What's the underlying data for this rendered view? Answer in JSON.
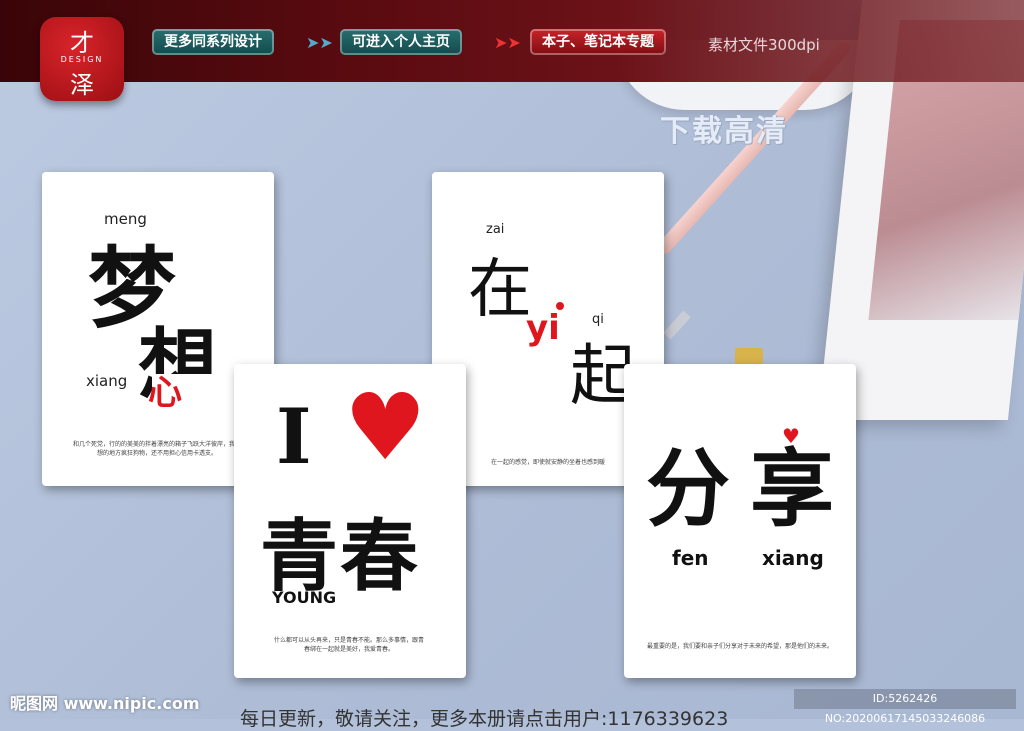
{
  "logo": {
    "top": "才",
    "middle": "DESIGN",
    "bottom": "泽"
  },
  "nav": [
    {
      "label": "更多同系列设计"
    },
    {
      "label": "可进入个人主页"
    },
    {
      "label": "本子、笔记本专题"
    }
  ],
  "resolution": "素材文件300dpi",
  "download": "下载高清",
  "cards": {
    "dream": {
      "pin1": "meng",
      "char1": "梦",
      "pin2": "xiang",
      "char2": "想",
      "text": "和几个死党，行的的美美的拌着漂亮的箱子飞跃大洋彼岸，我梦想的地方疯狂狗物，还不用担心信用卡透支。"
    },
    "youth": {
      "letter": "I",
      "chars": "青春",
      "young": "YOUNG",
      "text": "什么都可以从头再来，只是青春不能。那么多事情，跟青春绑在一起就是美好，我爱青春。"
    },
    "together": {
      "pin1": "zai",
      "char1": "在",
      "pin2": "yi",
      "pin3": "qi",
      "char3": "起",
      "text": "在一起的感觉，即使就安静的坐着也感到暖"
    },
    "share": {
      "char1": "分",
      "char2": "享",
      "pin1": "fen",
      "pin2": "xiang",
      "text": "最重要的是，我们要和亲子们分享对于未来的希望，那是他们的未来。"
    }
  },
  "footer": {
    "site": "昵图网 www.nipic.com",
    "id": "ID:5262426 NO:20200617145033246086",
    "text": "每日更新，敬请关注，更多本册请点击用户:1176339623"
  }
}
